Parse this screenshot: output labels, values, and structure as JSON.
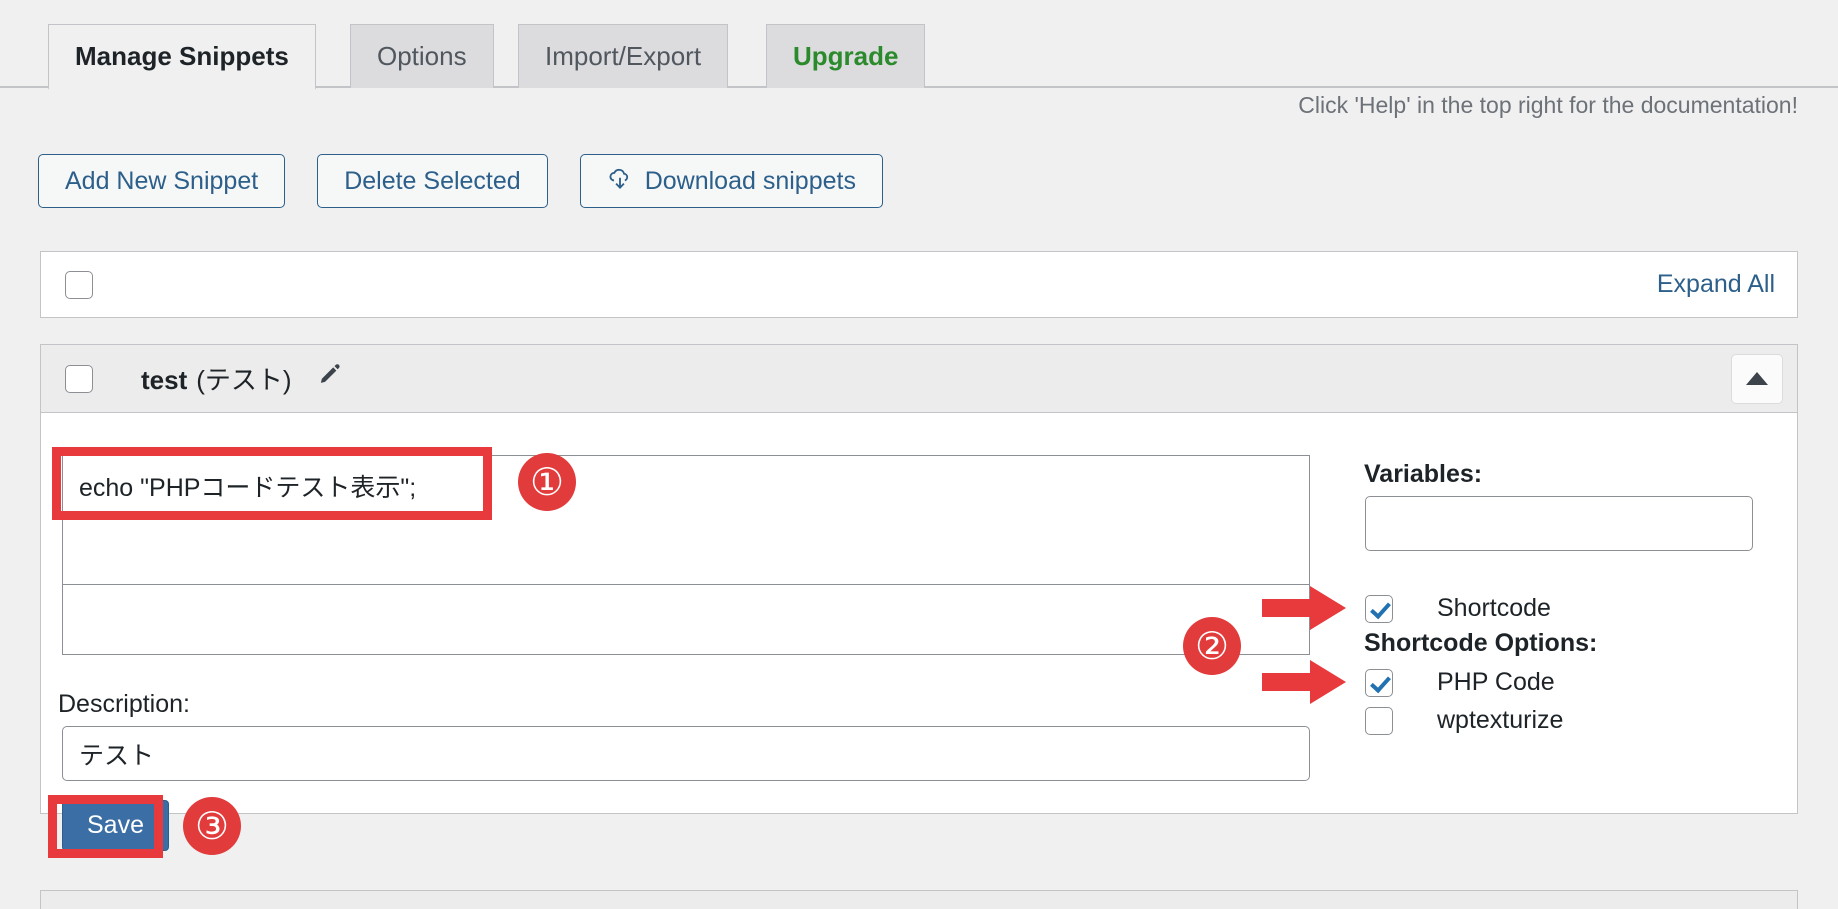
{
  "tabs": [
    {
      "label": "Manage Snippets",
      "state": "active"
    },
    {
      "label": "Options",
      "state": "inactive"
    },
    {
      "label": "Import/Export",
      "state": "inactive"
    },
    {
      "label": "Upgrade",
      "state": "upgrade"
    }
  ],
  "help_note": "Click 'Help' in the top right for the documentation!",
  "actions": {
    "add_new": "Add New Snippet",
    "delete_selected": "Delete Selected",
    "download": "Download snippets"
  },
  "bulk_bar": {
    "expand_all": "Expand All"
  },
  "snippet": {
    "name": "test",
    "name_localized": "(テスト)",
    "code": "echo \"PHPコードテスト表示\";",
    "description_label": "Description:",
    "description_value": "テスト",
    "description_placeholder": "",
    "save_label": "Save",
    "variables_label": "Variables:",
    "variables_value": "",
    "variables_placeholder": "",
    "shortcode_label": "Shortcode",
    "shortcode_checked": true,
    "shortcode_options_label": "Shortcode Options:",
    "php_code_label": "PHP Code",
    "php_code_checked": true,
    "wptexturize_label": "wptexturize",
    "wptexturize_checked": false
  },
  "annotations": {
    "badge1": "①",
    "badge2": "②",
    "badge3": "③"
  },
  "colors": {
    "accent_blue": "#2d5f8b",
    "upgrade_green": "#2b8a2b",
    "annotation_red": "#e8393c",
    "save_button": "#3a6ea5",
    "checkbox_check": "#2271b1"
  }
}
